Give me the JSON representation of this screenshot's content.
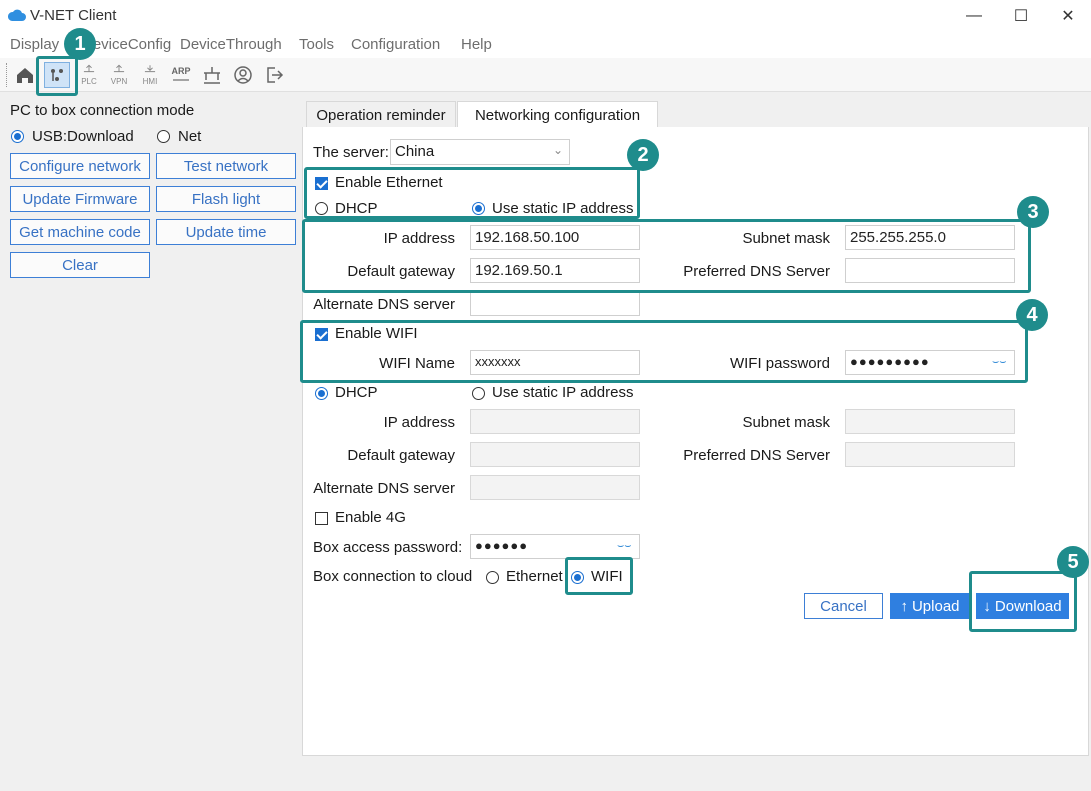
{
  "window": {
    "title": "V-NET Client",
    "minimize": "—",
    "maximize": "☐",
    "close": "✕"
  },
  "menu": [
    "Display",
    "DeviceConfig",
    "DeviceThrough",
    "Tools",
    "Configuration",
    "Help"
  ],
  "toolbar_icons": [
    "home-icon",
    "usb-box-icon",
    "plc-icon",
    "vpn-icon",
    "hmi-icon",
    "arp-icon",
    "network-icon",
    "user-icon",
    "logout-icon"
  ],
  "toolbar_text": {
    "plc": "PLC",
    "vpn": "VPN",
    "hmi": "HMI",
    "arp": "ARP"
  },
  "left": {
    "mode_label": "PC to box connection mode",
    "mode_usb": "USB:Download",
    "mode_net": "Net",
    "buttons": {
      "configure_network": "Configure network",
      "test_network": "Test network",
      "update_firmware": "Update Firmware",
      "flash_light": "Flash light",
      "get_machine_code": "Get machine code",
      "update_time": "Update time",
      "clear": "Clear"
    }
  },
  "tabs": {
    "operation": "Operation reminder",
    "networking": "Networking configuration"
  },
  "server": {
    "label": "The server:",
    "value": "China"
  },
  "ethernet": {
    "enable_label": "Enable Ethernet",
    "dhcp": "DHCP",
    "static": "Use static IP address",
    "ip_label": "IP address",
    "ip_value": "192.168.50.100",
    "mask_label": "Subnet mask",
    "mask_value": "255.255.255.0",
    "gateway_label": "Default gateway",
    "gateway_value": "192.169.50.1",
    "dns_label": "Preferred DNS Server",
    "dns_value": "",
    "alt_dns_label": "Alternate DNS server",
    "alt_dns_value": ""
  },
  "wifi": {
    "enable_label": "Enable WIFI",
    "name_label": "WIFI Name",
    "name_value": "xxxxxxx",
    "password_label": "WIFI password",
    "password_value": "●●●●●●●●●",
    "dhcp": "DHCP",
    "static": "Use static IP address",
    "ip_label": "IP address",
    "mask_label": "Subnet mask",
    "gateway_label": "Default gateway",
    "dns_label": "Preferred DNS Server",
    "alt_dns_label": "Alternate DNS server"
  },
  "g4": {
    "enable_label": "Enable 4G"
  },
  "box": {
    "password_label": "Box access password:",
    "password_value": "●●●●●●",
    "cloud_label": "Box connection to cloud",
    "cloud_ethernet": "Ethernet",
    "cloud_wifi": "WIFI"
  },
  "actions": {
    "cancel": "Cancel",
    "upload": "Upload",
    "download": "Download"
  },
  "badges": [
    "1",
    "2",
    "3",
    "4",
    "5"
  ],
  "colors": {
    "accent": "#1a6fd1",
    "highlight": "#1f8c8c",
    "primary_button": "#2f7fe0"
  }
}
